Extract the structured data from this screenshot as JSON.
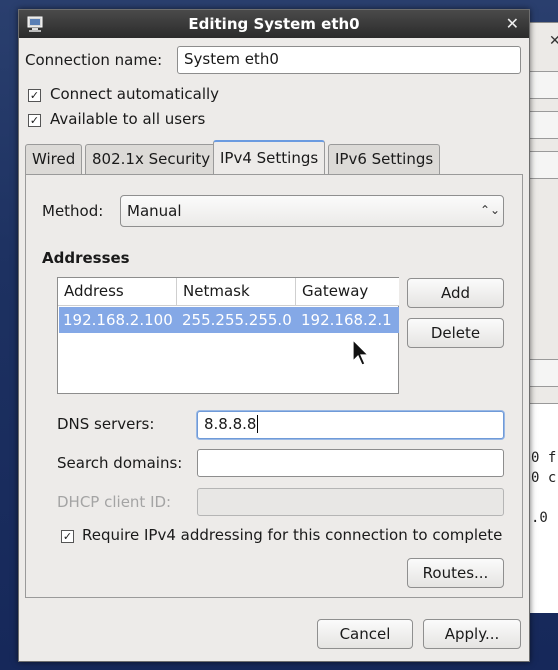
{
  "window": {
    "title": "Editing System eth0"
  },
  "connection": {
    "name_label": "Connection name:",
    "name_value": "System eth0",
    "connect_auto_label": "Connect automatically",
    "connect_auto_checked": true,
    "all_users_label": "Available to all users",
    "all_users_checked": true
  },
  "tabs": [
    {
      "label": "Wired",
      "active": false
    },
    {
      "label": "802.1x Security",
      "active": false
    },
    {
      "label": "IPv4 Settings",
      "active": true
    },
    {
      "label": "IPv6 Settings",
      "active": false
    }
  ],
  "ipv4": {
    "method_label": "Method:",
    "method_value": "Manual",
    "addresses_heading": "Addresses",
    "columns": [
      "Address",
      "Netmask",
      "Gateway"
    ],
    "rows": [
      {
        "address": "192.168.2.100",
        "netmask": "255.255.255.0",
        "gateway": "192.168.2.1"
      }
    ],
    "add_label": "Add",
    "delete_label": "Delete",
    "dns_label": "DNS servers:",
    "dns_value": "8.8.8.8",
    "search_label": "Search domains:",
    "search_value": "",
    "dhcp_label": "DHCP client ID:",
    "dhcp_value": "",
    "require_label": "Require IPv4 addressing for this connection to complete",
    "require_checked": true,
    "routes_label": "Routes..."
  },
  "footer": {
    "cancel_label": "Cancel",
    "apply_label": "Apply..."
  },
  "background_terminal": {
    "lines": [
      "0 f",
      "0 c",
      ".0"
    ]
  }
}
